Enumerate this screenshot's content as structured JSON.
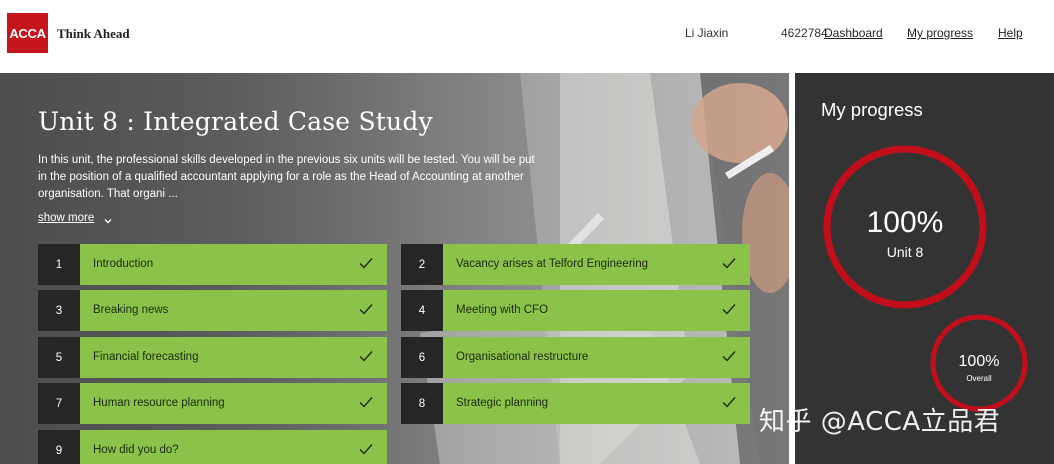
{
  "header": {
    "logo_text": "ACCA",
    "tagline": "Think Ahead",
    "user_name": "Li Jiaxin",
    "user_id": "4622784",
    "nav": {
      "dashboard": "Dashboard",
      "my_progress": "My progress",
      "help": "Help"
    }
  },
  "hero": {
    "title": "Unit 8 : Integrated Case Study",
    "description": "In this unit, the professional skills developed in the previous six units will be tested. You will be put in the position of a qualified accountant applying for a role as the Head of Accounting at another organisation. That organi ...",
    "show_more": "show more",
    "show_more_icon": "chevron-down-icon"
  },
  "lessons": [
    {
      "number": "1",
      "label": "Introduction",
      "completed": true
    },
    {
      "number": "2",
      "label": "Vacancy arises at Telford Engineering",
      "completed": true
    },
    {
      "number": "3",
      "label": "Breaking news",
      "completed": true
    },
    {
      "number": "4",
      "label": "Meeting with CFO",
      "completed": true
    },
    {
      "number": "5",
      "label": "Financial forecasting",
      "completed": true
    },
    {
      "number": "6",
      "label": "Organisational restructure",
      "completed": true
    },
    {
      "number": "7",
      "label": "Human resource planning",
      "completed": true
    },
    {
      "number": "8",
      "label": "Strategic planning",
      "completed": true
    },
    {
      "number": "9",
      "label": "How did you do?",
      "completed": true
    }
  ],
  "progress": {
    "title": "My progress",
    "unit": {
      "percent_text": "100%",
      "label": "Unit 8",
      "fraction": 1.0
    },
    "overall": {
      "percent_text": "100%",
      "label": "Overall",
      "fraction": 1.0
    }
  },
  "watermark": "知乎 @ACCA立品君",
  "colors": {
    "brand_red": "#c4161c",
    "lesson_green": "#8bc34a",
    "number_block": "#262626",
    "panel_bg": "#333333",
    "ring_red": "#c20e1a"
  }
}
